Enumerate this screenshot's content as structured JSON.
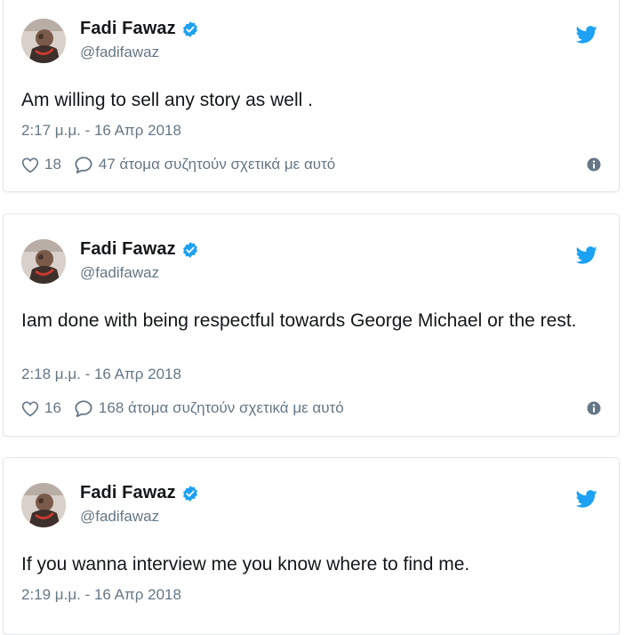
{
  "colors": {
    "text": "#14171a",
    "secondary": "#657786",
    "twitter_blue": "#1da1f2",
    "border": "#e1e8ed"
  },
  "icons": [
    "profile-avatar",
    "verified-badge-icon",
    "twitter-bird-icon",
    "heart-icon",
    "reply-bubble-icon",
    "info-icon"
  ],
  "tweets": [
    {
      "display_name": "Fadi Fawaz",
      "handle": "@fadifawaz",
      "text": "Am willing to sell any story as well .",
      "timestamp": "2:17 μ.μ. - 16 Απρ 2018",
      "likes": "18",
      "replies": "47 άτομα συζητούν σχετικά με αυτό"
    },
    {
      "display_name": "Fadi Fawaz",
      "handle": "@fadifawaz",
      "text": "Iam done with being respectful towards George Michael or the rest.",
      "timestamp": "2:18 μ.μ. - 16 Απρ 2018",
      "likes": "16",
      "replies": "168 άτομα συζητούν σχετικά με αυτό"
    },
    {
      "display_name": "Fadi Fawaz",
      "handle": "@fadifawaz",
      "text": "If you wanna interview me you know where to find me.",
      "timestamp": "2:19 μ.μ. - 16 Απρ 2018"
    }
  ]
}
